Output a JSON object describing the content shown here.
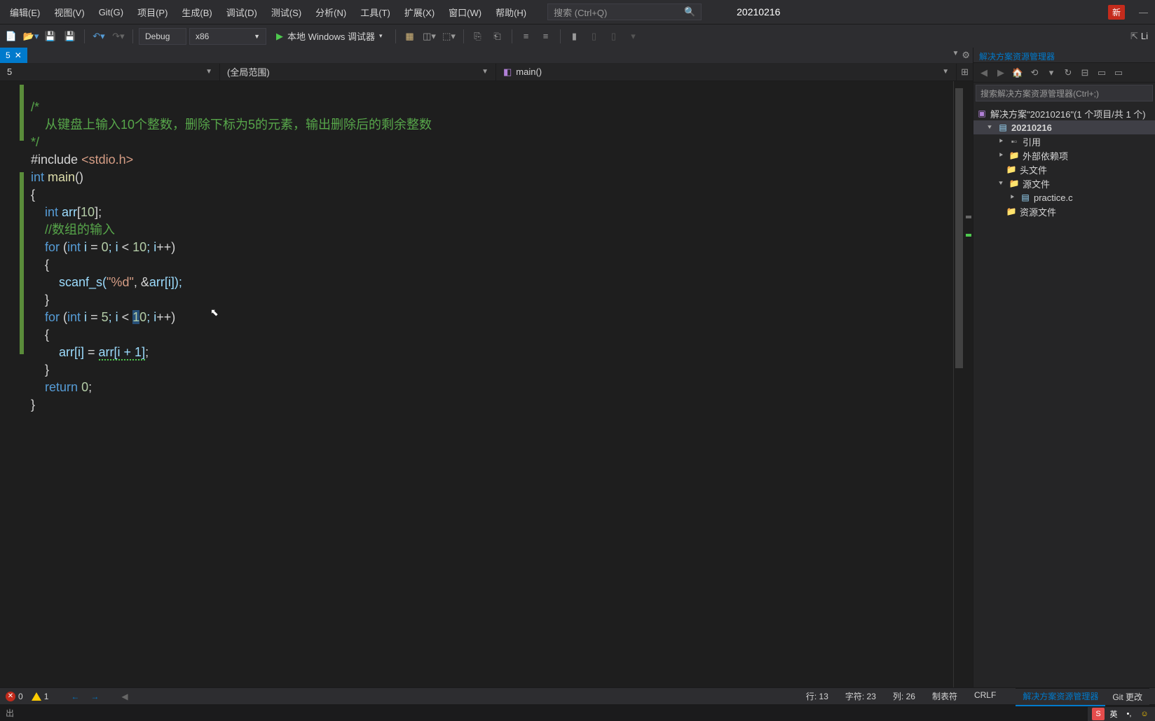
{
  "menu": {
    "items": [
      "编辑(E)",
      "视图(V)",
      "Git(G)",
      "项目(P)",
      "生成(B)",
      "调试(D)",
      "测试(S)",
      "分析(N)",
      "工具(T)",
      "扩展(X)",
      "窗口(W)",
      "帮助(H)"
    ]
  },
  "search_placeholder": "搜索 (Ctrl+Q)",
  "project_name": "20210216",
  "new_badge": "新",
  "toolbar": {
    "config": "Debug",
    "platform": "x86",
    "debugger": "本地 Windows 调试器",
    "live": "Li"
  },
  "tab": {
    "close": "✕"
  },
  "nav": {
    "scope": "(全局范围)",
    "func": "main()"
  },
  "code": {
    "l1": "/*",
    "l2": "    从键盘上输入10个整数，删除下标为5的元素，输出删除后的剩余整数",
    "l3": "*/",
    "l4a": "#include ",
    "l4b": "<stdio.h>",
    "l5a": "int",
    "l5b": " main",
    "l5c": "()",
    "l6": "{",
    "l7a": "    ",
    "l7b": "int",
    "l7c": " arr",
    "l7d": "[",
    "l7e": "10",
    "l7f": "];",
    "l8": "    //数组的输入",
    "l9a": "    ",
    "l9b": "for",
    "l9c": " (",
    "l9d": "int",
    "l9e": " i ",
    "l9f": "=",
    "l9g": " ",
    "l9h": "0",
    "l9i": "; i ",
    "l9j": "<",
    "l9k": " ",
    "l9l": "10",
    "l9m": "; i",
    "l9n": "++",
    "l9o": ")",
    "l10": "    {",
    "l11a": "        scanf_s(",
    "l11b": "\"%d\"",
    "l11c": ", ",
    "l11d": "&",
    "l11e": "arr[i]);",
    "l12": "    }",
    "l13a": "    ",
    "l13b": "for",
    "l13c": " (",
    "l13d": "int",
    "l13e": " i ",
    "l13f": "=",
    "l13g": " ",
    "l13h": "5",
    "l13i": "; i ",
    "l13j": "<",
    "l13k": " ",
    "l13l": "1",
    "l13m": "0",
    "l13n": "; i",
    "l13o": "++",
    "l13p": ")",
    "l14": "    {",
    "l15a": "        arr[i] ",
    "l15b": "=",
    "l15c": " ",
    "l15d": "arr[i + 1]",
    "l15e": ";",
    "l16": "    }",
    "l17a": "    ",
    "l17b": "return",
    "l17c": " ",
    "l17d": "0",
    "l17e": ";",
    "l18": "}"
  },
  "solution": {
    "title": "解决方案资源管理器",
    "search_placeholder": "搜索解决方案资源管理器(Ctrl+;)",
    "root": "解决方案\"20210216\"(1 个项目/共 1 个)",
    "project": "20210216",
    "refs": "引用",
    "external": "外部依赖项",
    "headers": "头文件",
    "sources": "源文件",
    "file": "practice.c",
    "resources": "资源文件"
  },
  "errors": {
    "err_count": "0",
    "warn_count": "1"
  },
  "status": {
    "line": "行: 13",
    "char": "字符: 23",
    "col": "列: 26",
    "tabs": "制表符",
    "eol": "CRLF"
  },
  "side_tabs": {
    "solution": "解决方案资源管理器",
    "git": "Git 更改"
  },
  "output_label": "出",
  "ime": {
    "lang": "英"
  }
}
